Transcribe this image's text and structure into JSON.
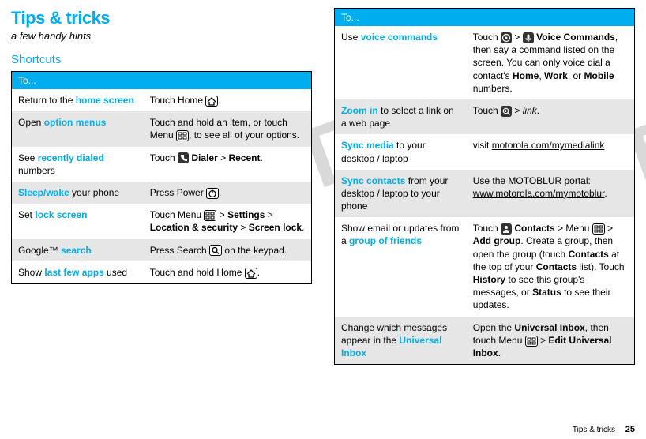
{
  "title": "Tips & tricks",
  "subtitle": "a few handy hints",
  "section": "Shortcuts",
  "header": "To...",
  "footer_label": "Tips & tricks",
  "page_number": "25",
  "left_rows": [
    {
      "c1_pre": "Return to the ",
      "c1_hl": "home screen",
      "c1_post": "",
      "c2_parts": [
        "Touch Home ",
        {
          "icon": "home"
        },
        "."
      ]
    },
    {
      "c1_pre": "Open ",
      "c1_hl": "option menus",
      "c1_post": "",
      "c2_parts": [
        "Touch and hold an item, or touch Menu ",
        {
          "icon": "menu"
        },
        ", to see all of your options."
      ]
    },
    {
      "c1_pre": "See ",
      "c1_hl": "recently dialed",
      "c1_post": " numbers",
      "c2_parts": [
        "Touch ",
        {
          "icon": "dial",
          "dark": true
        },
        " ",
        {
          "bold": "Dialer"
        },
        " > ",
        {
          "bold": "Recent"
        },
        "."
      ]
    },
    {
      "c1_pre": "",
      "c1_hl": "Sleep/wake",
      "c1_post": " your phone",
      "c2_parts": [
        "Press Power ",
        {
          "icon": "power"
        },
        "."
      ]
    },
    {
      "c1_pre": "Set ",
      "c1_hl": "lock screen",
      "c1_post": "",
      "c2_parts": [
        "Touch Menu ",
        {
          "icon": "menu"
        },
        " > ",
        {
          "bold": "Settings"
        },
        " > ",
        {
          "bold": "Location & security"
        },
        " > ",
        {
          "bold": "Screen lock"
        },
        "."
      ]
    },
    {
      "c1_pre": "Google™ ",
      "c1_hl": "search",
      "c1_post": "",
      "c2_parts": [
        "Press Search ",
        {
          "icon": "search"
        },
        " on the keypad."
      ]
    },
    {
      "c1_pre": "Show ",
      "c1_hl": "last few apps",
      "c1_post": " used",
      "c2_parts": [
        "Touch and hold Home ",
        {
          "icon": "home"
        },
        "."
      ]
    }
  ],
  "right_rows": [
    {
      "c1_pre": "Use ",
      "c1_hl": "voice commands",
      "c1_post": "",
      "c2_parts": [
        "Touch ",
        {
          "icon": "apps",
          "dark": true
        },
        " > ",
        {
          "icon": "voice",
          "dark": true
        },
        " ",
        {
          "bold": "Voice Commands"
        },
        ", then say a command listed on the screen. You can only voice dial a contact's ",
        {
          "bold": "Home"
        },
        ", ",
        {
          "bold": "Work"
        },
        ", or ",
        {
          "bold": "Mobile"
        },
        " numbers."
      ]
    },
    {
      "c1_pre": "",
      "c1_hl": "Zoom in",
      "c1_post": " to select a link on a web page",
      "c2_parts": [
        "Touch ",
        {
          "icon": "zoom",
          "dark": true
        },
        " > ",
        {
          "ital": "link"
        },
        "."
      ]
    },
    {
      "c1_pre": "",
      "c1_hl": "Sync media",
      "c1_post": " to your desktop / laptop",
      "c2_parts": [
        "visit ",
        {
          "ul": "motorola.com/mymedialink"
        }
      ]
    },
    {
      "c1_pre": "",
      "c1_hl": "Sync contacts",
      "c1_post": " from your desktop / laptop to your phone",
      "c2_parts": [
        "Use the MOTOBLUR portal: ",
        {
          "ul": "www.motorola.com/mymotoblur"
        },
        "."
      ]
    },
    {
      "c1_pre": "Show email or updates from a ",
      "c1_hl": "group of friends",
      "c1_post": "",
      "c2_parts": [
        "Touch ",
        {
          "icon": "contacts",
          "dark": true
        },
        " ",
        {
          "bold": "Contacts"
        },
        " > Menu ",
        {
          "icon": "menu"
        },
        " > ",
        {
          "bold": "Add group"
        },
        ". Create a group, then open the group (touch ",
        {
          "bold": "Contacts"
        },
        " at the top of your ",
        {
          "bold": "Contacts"
        },
        " list). Touch ",
        {
          "bold": "History"
        },
        " to see this group's messages, or ",
        {
          "bold": "Status"
        },
        " to see their updates."
      ]
    },
    {
      "c1_pre": "Change which messages appear in the ",
      "c1_hl": "Universal Inbox",
      "c1_post": "",
      "c2_parts": [
        "Open the ",
        {
          "bold": "Universal Inbox"
        },
        ", then touch Menu ",
        {
          "icon": "menu"
        },
        " > ",
        {
          "bold": "Edit Universal Inbox"
        },
        "."
      ]
    }
  ]
}
